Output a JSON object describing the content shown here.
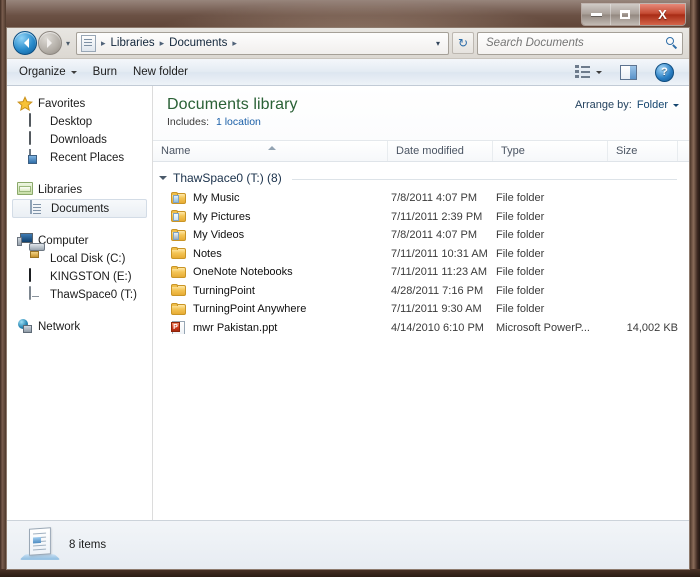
{
  "window": {
    "caption_buttons": {
      "minimize": "Minimize",
      "maximize": "Maximize",
      "close": "X"
    }
  },
  "addressbar": {
    "back": "Back",
    "forward": "Forward",
    "history_dropdown": "▾",
    "breadcrumbs": [
      "Libraries",
      "Documents"
    ],
    "separator": "▸",
    "crumb_dropdown": "▾",
    "refresh": "↻",
    "search": {
      "placeholder": "Search Documents",
      "value": ""
    }
  },
  "toolbar": {
    "organize_label": "Organize",
    "burn_label": "Burn",
    "new_folder_label": "New folder",
    "change_view_label": "Change your view",
    "preview_pane_label": "Show the preview pane",
    "help_label": "?"
  },
  "navpane": {
    "groups": [
      {
        "name": "Favorites",
        "icon": "star-icon",
        "items": [
          {
            "label": "Desktop",
            "icon": "monitor-icon"
          },
          {
            "label": "Downloads",
            "icon": "monitor-icon"
          },
          {
            "label": "Recent Places",
            "icon": "recent-places-icon"
          }
        ]
      },
      {
        "name": "Libraries",
        "icon": "library-folder-icon",
        "items": [
          {
            "label": "Documents",
            "icon": "document-icon",
            "selected": true
          }
        ]
      },
      {
        "name": "Computer",
        "icon": "computer-icon",
        "items": [
          {
            "label": "Local Disk (C:)",
            "icon": "hard-disk-icon"
          },
          {
            "label": "KINGSTON (E:)",
            "icon": "usb-drive-icon"
          },
          {
            "label": "ThawSpace0 (T:)",
            "icon": "drive-icon"
          }
        ]
      },
      {
        "name": "Network",
        "icon": "network-icon",
        "items": []
      }
    ]
  },
  "library": {
    "title": "Documents library",
    "includes_label": "Includes:",
    "includes_link": "1 location",
    "arrange_by_label": "Arrange by:",
    "arrange_by_value": "Folder"
  },
  "columns": {
    "name": "Name",
    "date_modified": "Date modified",
    "type": "Type",
    "size": "Size"
  },
  "group": {
    "label": "ThawSpace0 (T:) (8)"
  },
  "files": [
    {
      "name": "My Music",
      "date": "7/8/2011 4:07 PM",
      "type": "File folder",
      "size": "",
      "icon": "folder-music-icon"
    },
    {
      "name": "My Pictures",
      "date": "7/11/2011 2:39 PM",
      "type": "File folder",
      "size": "",
      "icon": "folder-pictures-icon"
    },
    {
      "name": "My Videos",
      "date": "7/8/2011 4:07 PM",
      "type": "File folder",
      "size": "",
      "icon": "folder-videos-icon"
    },
    {
      "name": "Notes",
      "date": "7/11/2011 10:31 AM",
      "type": "File folder",
      "size": "",
      "icon": "folder-icon"
    },
    {
      "name": "OneNote Notebooks",
      "date": "7/11/2011 11:23 AM",
      "type": "File folder",
      "size": "",
      "icon": "folder-icon"
    },
    {
      "name": "TurningPoint",
      "date": "4/28/2011 7:16 PM",
      "type": "File folder",
      "size": "",
      "icon": "folder-icon"
    },
    {
      "name": "TurningPoint Anywhere",
      "date": "7/11/2011 9:30 AM",
      "type": "File folder",
      "size": "",
      "icon": "folder-icon"
    },
    {
      "name": "mwr Pakistan.ppt",
      "date": "4/14/2010 6:10 PM",
      "type": "Microsoft PowerP...",
      "size": "14,002 KB",
      "icon": "powerpoint-icon"
    }
  ],
  "statusbar": {
    "item_count": "8 items"
  },
  "colors": {
    "frame": "#4a3126",
    "library_title": "#2a6136",
    "link": "#1a5fa8",
    "folder": "#f3c455",
    "powerpoint": "#cf3a1c"
  }
}
